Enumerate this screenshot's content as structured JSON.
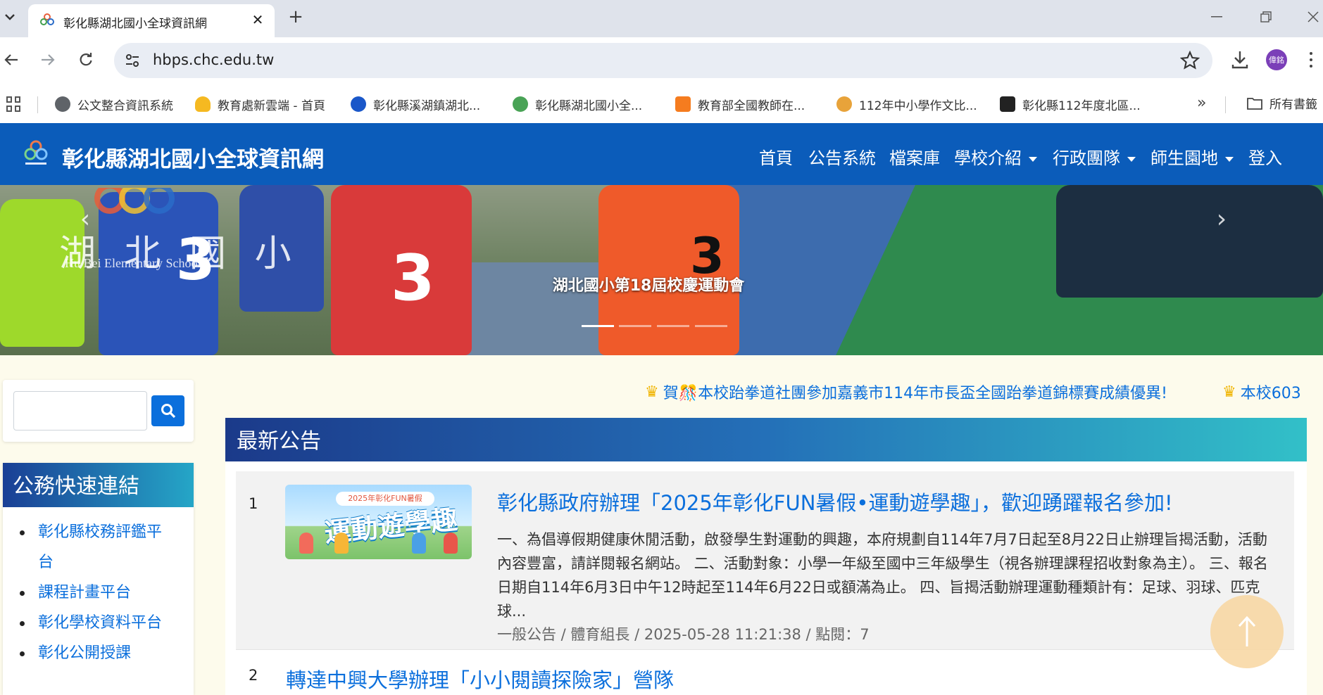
{
  "browser": {
    "tab_title": "彰化縣湖北國小全球資訊網",
    "url": "hbps.chc.edu.tw",
    "profile_label": "偉銘",
    "bookmarks": [
      {
        "label": "公文整合資訊系統",
        "icon": "globe-icon",
        "color": "#5f6368"
      },
      {
        "label": "教育處新雲端 - 首頁",
        "icon": "cloud-icon",
        "color": "#f5b921"
      },
      {
        "label": "彰化縣溪湖鎮湖北...",
        "icon": "circle-logo-icon",
        "color": "#1a57c9"
      },
      {
        "label": "彰化縣湖北國小全...",
        "icon": "school-logo-icon",
        "color": "#49a356"
      },
      {
        "label": "教育部全國教師在...",
        "icon": "orange-app-icon",
        "color": "#f57c1f"
      },
      {
        "label": "112年中小學作文比...",
        "icon": "flower-icon",
        "color": "#e8a33a"
      },
      {
        "label": "彰化縣112年度北區...",
        "icon": "study-char-icon",
        "color": "#222222"
      }
    ],
    "all_bookmarks_label": "所有書籤"
  },
  "site": {
    "title": "彰化縣湖北國小全球資訊網",
    "header_color": "#0b5cba",
    "nav": [
      {
        "label": "首頁",
        "dropdown": false
      },
      {
        "label": "公告系統",
        "dropdown": false
      },
      {
        "label": "檔案庫",
        "dropdown": false
      },
      {
        "label": "學校介紹",
        "dropdown": true
      },
      {
        "label": "行政團隊",
        "dropdown": true
      },
      {
        "label": "師生園地",
        "dropdown": true
      },
      {
        "label": "登入",
        "dropdown": false
      }
    ]
  },
  "hero": {
    "caption": "湖北國小第18屆校慶運動會",
    "logo_text": "湖 北 國 小",
    "logo_subtext": "Hu Bei Elementary School",
    "runner_numbers": [
      "3",
      "3",
      "3"
    ],
    "slide_count": 4,
    "active_slide": 1
  },
  "sidebar": {
    "search_placeholder": "",
    "links_title": "公務快速連結",
    "links": [
      "彰化縣校務評鑑平台",
      "課程計畫平台",
      "彰化學校資料平台",
      "彰化公開授課"
    ]
  },
  "marquee": {
    "items": [
      "賀🎊本校跆拳道社團參加嘉義市114年市長盃全國跆拳道錦標賽成績優異!",
      "本校603"
    ]
  },
  "announcements": {
    "title": "最新公告",
    "items": [
      {
        "num": "1",
        "thumb_banner": "2025年彰化FUN暑假",
        "thumb_title": "運動遊學趣",
        "title": "彰化縣政府辦理「2025年彰化FUN暑假•運動遊學趣」，歡迎踴躍報名參加!",
        "body": "一、為倡導假期健康休閒活動，啟發學生對運動的興趣，本府規劃自114年7月7日起至8月22日止辦理旨揭活動，活動內容豐富，請詳閱報名網站。 二、活動對象：小學一年級至國中三年級學生（視各辦理課程招收對象為主）。 三、報名日期自114年6月3日中午12時起至114年6月22日或額滿為止。 四、旨揭活動辦理運動種類計有：足球、羽球、匹克球...",
        "meta": "一般公告 / 體育組長 / 2025-05-28 11:21:38 / 點閱：7"
      },
      {
        "num": "2",
        "title": "轉達中興大學辦理「小小閱讀探險家」營隊"
      }
    ]
  }
}
